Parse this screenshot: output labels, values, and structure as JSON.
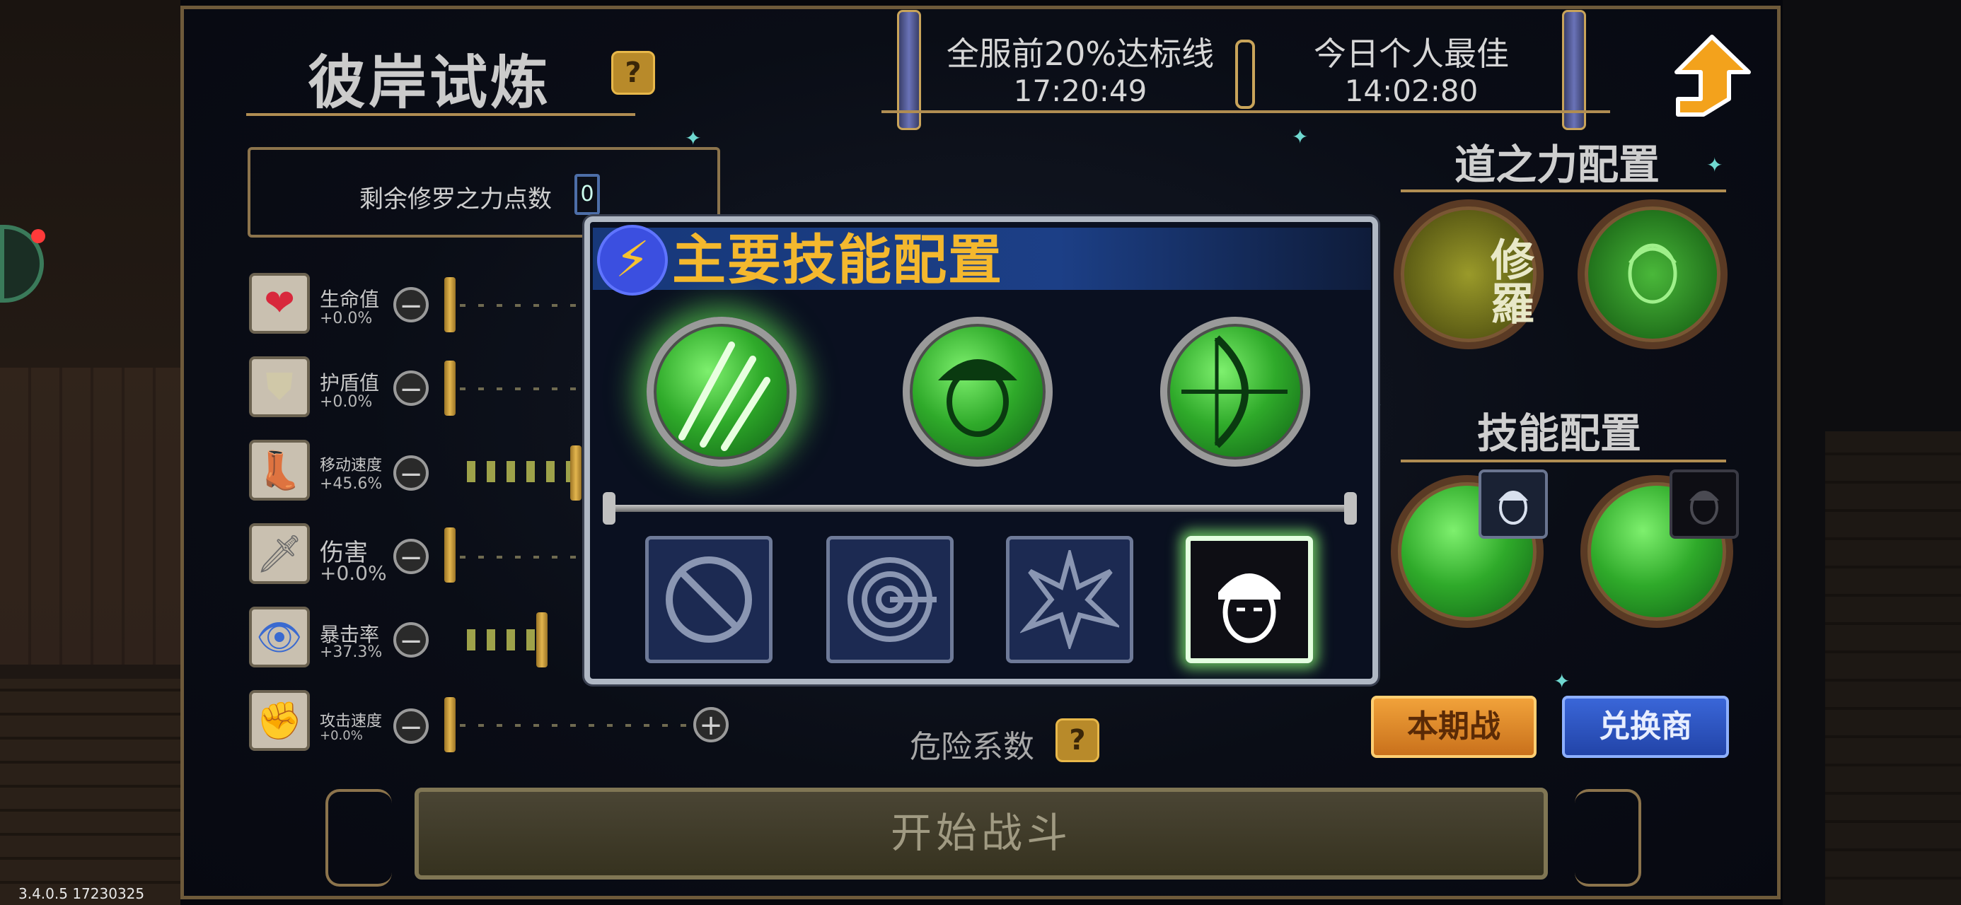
{
  "game": {
    "title": "彼岸试炼",
    "help_symbol": "?",
    "version": "3.4.0.5 17230325"
  },
  "points": {
    "label": "剩余修罗之力点数",
    "value": "0"
  },
  "stats": [
    {
      "name": "生命值",
      "value": "+0.0%",
      "icon": "heart-icon",
      "level": 0
    },
    {
      "name": "护盾值",
      "value": "+0.0%",
      "icon": "shield-icon",
      "level": 0
    },
    {
      "name": "移动速度",
      "value": "+45.6%",
      "icon": "boot-icon",
      "level": 0.4
    },
    {
      "name": "伤害",
      "value": "+0.0%",
      "icon": "sword-icon",
      "level": 0
    },
    {
      "name": "暴击率",
      "value": "+37.3%",
      "icon": "eye-icon",
      "level": 0.3
    },
    {
      "name": "攻击速度",
      "value": "+0.0%",
      "icon": "fist-icon",
      "level": 0
    }
  ],
  "timers": {
    "left_label": "全服前20%达标线",
    "left_time": "17:20:49",
    "right_label": "今日个人最佳",
    "right_time": "14:02:80"
  },
  "right_panel": {
    "dao_title": "道之力配置",
    "dao_orb_label": "修羅",
    "skill_title": "技能配置",
    "season_button": "本期战",
    "exchange_button": "兑换商"
  },
  "danger": {
    "label": "危险系数"
  },
  "start_button": "开始战斗",
  "popup": {
    "title": "主要技能配置",
    "bolt_symbol": "⚡",
    "skills": [
      {
        "icon": "claw-slash-icon",
        "selected": true
      },
      {
        "icon": "hunter-portrait-icon",
        "selected": false
      },
      {
        "icon": "bow-icon",
        "selected": false
      }
    ],
    "options": [
      {
        "icon": "none-icon",
        "selected": false
      },
      {
        "icon": "target-icon",
        "selected": false
      },
      {
        "icon": "burst-icon",
        "selected": false
      },
      {
        "icon": "character-portrait-icon",
        "selected": true
      }
    ]
  },
  "colors": {
    "accent_gold": "#f4b82e",
    "popup_header": "#1c3f86",
    "skill_green": "#2faa2a",
    "season_orange": "#e08a2a",
    "exchange_blue": "#2c52c2"
  }
}
